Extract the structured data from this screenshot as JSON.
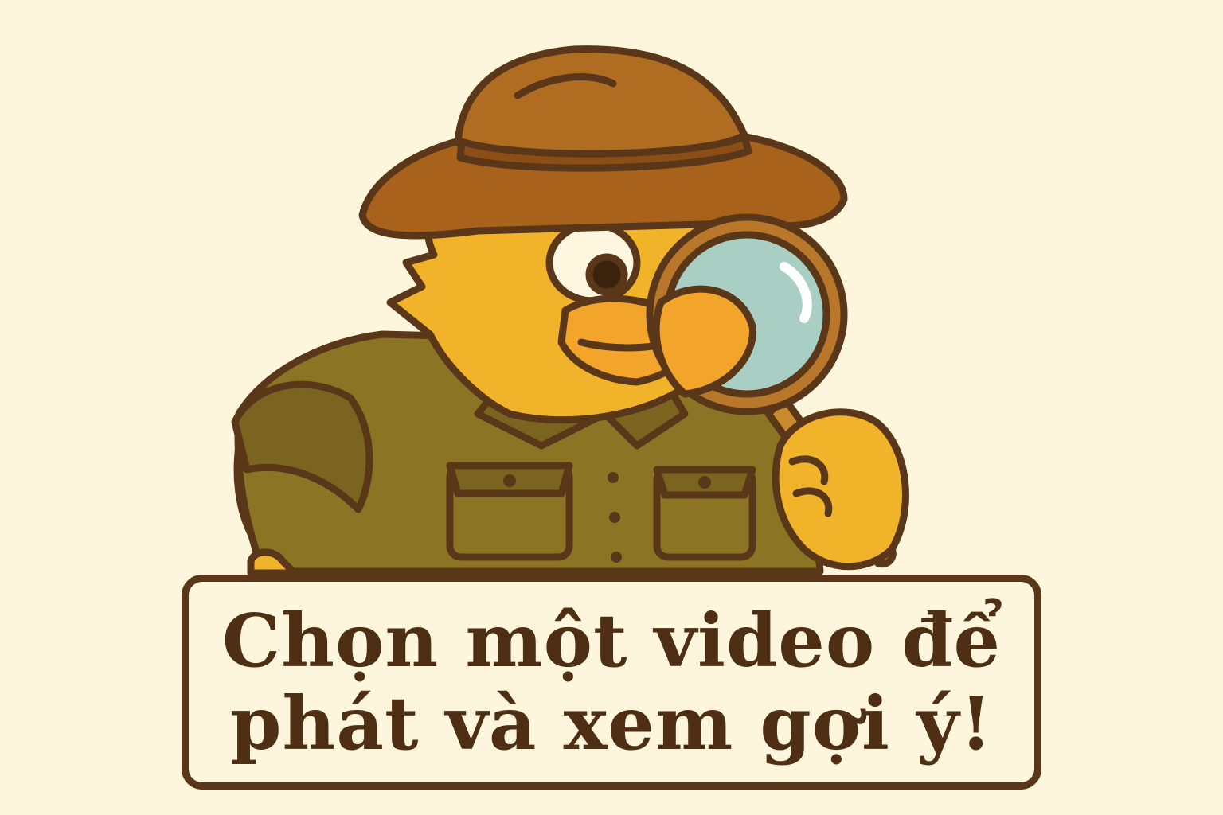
{
  "illustration": {
    "subject": "detective-bird-mascot",
    "icon": "magnifying-glass-icon",
    "colors": {
      "background": "#fdf6dc",
      "outline": "#5a3718",
      "bird_body": "#f0b32a",
      "hat": "#a8621c",
      "shirt": "#8b7424",
      "lens": "#a9cfc4",
      "text": "#4f2f14"
    }
  },
  "banner": {
    "line1": "Chọn một video để",
    "line2": "phát và xem gợi ý!"
  }
}
